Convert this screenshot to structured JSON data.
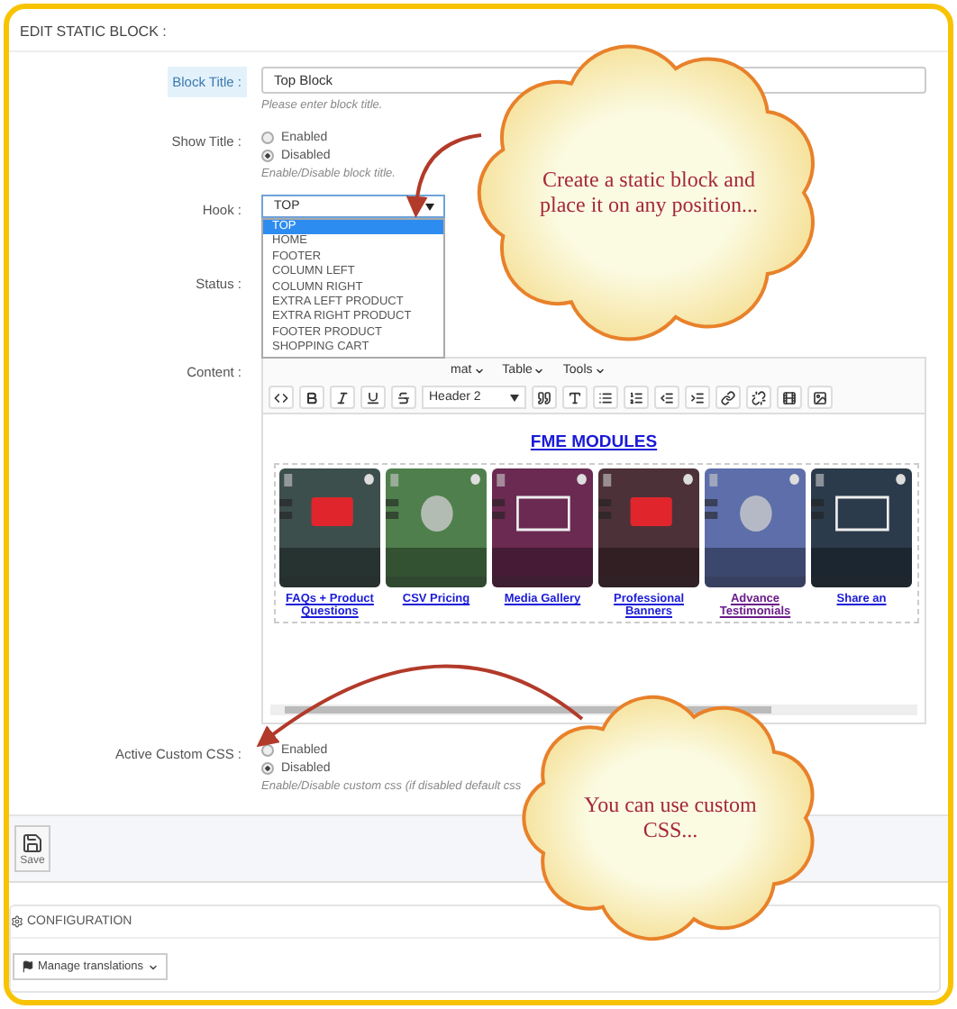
{
  "header": "EDIT STATIC BLOCK :",
  "block_title": {
    "label": "Block Title :",
    "value": "Top Block",
    "hint": "Please enter block title."
  },
  "show_title": {
    "label": "Show Title :",
    "options": [
      {
        "label": "Enabled",
        "selected": false
      },
      {
        "label": "Disabled",
        "selected": true
      }
    ],
    "hint": "Enable/Disable block title."
  },
  "hook": {
    "label": "Hook :",
    "value": "TOP",
    "expanded": true,
    "options": [
      {
        "label": "TOP",
        "selected": true
      },
      {
        "label": "HOME",
        "selected": false
      },
      {
        "label": "FOOTER",
        "selected": false
      },
      {
        "label": "COLUMN LEFT",
        "selected": false
      },
      {
        "label": "COLUMN RIGHT",
        "selected": false
      },
      {
        "label": "EXTRA LEFT PRODUCT",
        "selected": false
      },
      {
        "label": "EXTRA RIGHT PRODUCT",
        "selected": false
      },
      {
        "label": "FOOTER PRODUCT",
        "selected": false
      },
      {
        "label": "SHOPPING CART",
        "selected": false
      }
    ]
  },
  "status": {
    "label": "Status :"
  },
  "content": {
    "label": "Content :",
    "menus": [
      "mat",
      "Table",
      "Tools"
    ],
    "block_format": "Header 2",
    "heading": "FME MODULES",
    "modules": [
      {
        "caption": "FAQs + Product Questions",
        "visited": false,
        "color": "#3d4f4c"
      },
      {
        "caption": "CSV Pricing",
        "visited": false,
        "color": "#4f7f4c"
      },
      {
        "caption": "Media Gallery",
        "visited": false,
        "color": "#6b2a52"
      },
      {
        "caption": "Professional Banners",
        "visited": false,
        "color": "#4d3138"
      },
      {
        "caption": "Advance Testimonials",
        "visited": true,
        "color": "#5d6eaa"
      },
      {
        "caption": "Share an",
        "visited": false,
        "color": "#2c3b4b"
      }
    ]
  },
  "custom_css": {
    "label": "Active Custom CSS :",
    "options": [
      {
        "label": "Enabled",
        "selected": false
      },
      {
        "label": "Disabled",
        "selected": true
      }
    ],
    "hint": "Enable/Disable custom css (if disabled default css"
  },
  "save_button": "Save",
  "configuration": {
    "title": "CONFIGURATION",
    "translations_button": "Manage translations"
  },
  "callouts": [
    {
      "text": "Create a static block and place it on any position..."
    },
    {
      "text": "You can use custom CSS..."
    }
  ]
}
